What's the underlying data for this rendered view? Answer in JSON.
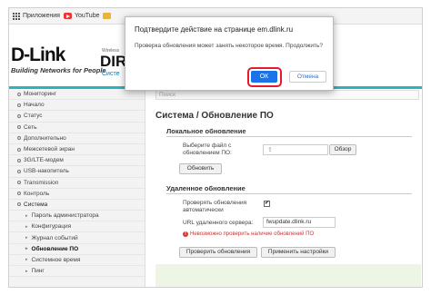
{
  "bookmarks": [
    {
      "label": "Приложения",
      "icon": "apps-icon"
    },
    {
      "label": "YouTube",
      "icon": "youtube-icon"
    },
    {
      "label": "",
      "icon": "folder-icon"
    }
  ],
  "header": {
    "logo": "D-Link",
    "tagline": "Building Networks for People",
    "model_small": "Wireless",
    "model": "DIR-",
    "model_sub": "Систе"
  },
  "sidebar": {
    "items": [
      {
        "label": "Мониторинг",
        "sub": false
      },
      {
        "label": "Начало",
        "sub": false
      },
      {
        "label": "Статус",
        "sub": false
      },
      {
        "label": "Сеть",
        "sub": false
      },
      {
        "label": "Дополнительно",
        "sub": false
      },
      {
        "label": "Межсетевой экран",
        "sub": false
      },
      {
        "label": "3G/LTE-модем",
        "sub": false
      },
      {
        "label": "USB-накопитель",
        "sub": false
      },
      {
        "label": "Transmission",
        "sub": false
      },
      {
        "label": "Контроль",
        "sub": false
      },
      {
        "label": "Система",
        "sub": false
      },
      {
        "label": "Пароль администратора",
        "sub": true
      },
      {
        "label": "Конфигурация",
        "sub": true
      },
      {
        "label": "Журнал событий",
        "sub": true
      },
      {
        "label": "Обновление ПО",
        "sub": true
      },
      {
        "label": "Системное время",
        "sub": true
      },
      {
        "label": "Пинг",
        "sub": true
      }
    ]
  },
  "main": {
    "search_placeholder": "Поиск",
    "page_title": "Система /  Обновление ПО",
    "local": {
      "title": "Локальное обновление",
      "file_label_1": "Выберите файл с",
      "file_label_2": "обновлением ПО:",
      "browse": "Обзор",
      "update": "Обновить"
    },
    "remote": {
      "title": "Удаленное обновление",
      "check_label_1": "Проверять обновления",
      "check_label_2": "автоматически",
      "check_mark": "✔",
      "url_label": "URL удаленного сервера:",
      "url_value": "fwupdate.dlink.ru",
      "warning": "Невозможно проверить наличие обновлений ПО",
      "check_button": "Проверить обновления",
      "apply_button": "Применить настройки"
    }
  },
  "dialog": {
    "title": "Подтвердите действие на странице em.dlink.ru",
    "message": "Проверка обновления может занять некоторое время. Продолжить?",
    "ok": "ОК",
    "cancel": "Отмена"
  },
  "colors": {
    "accent_line": "#2bb3c0",
    "ok_button": "#1a73e8",
    "highlight": "#e8192c"
  }
}
